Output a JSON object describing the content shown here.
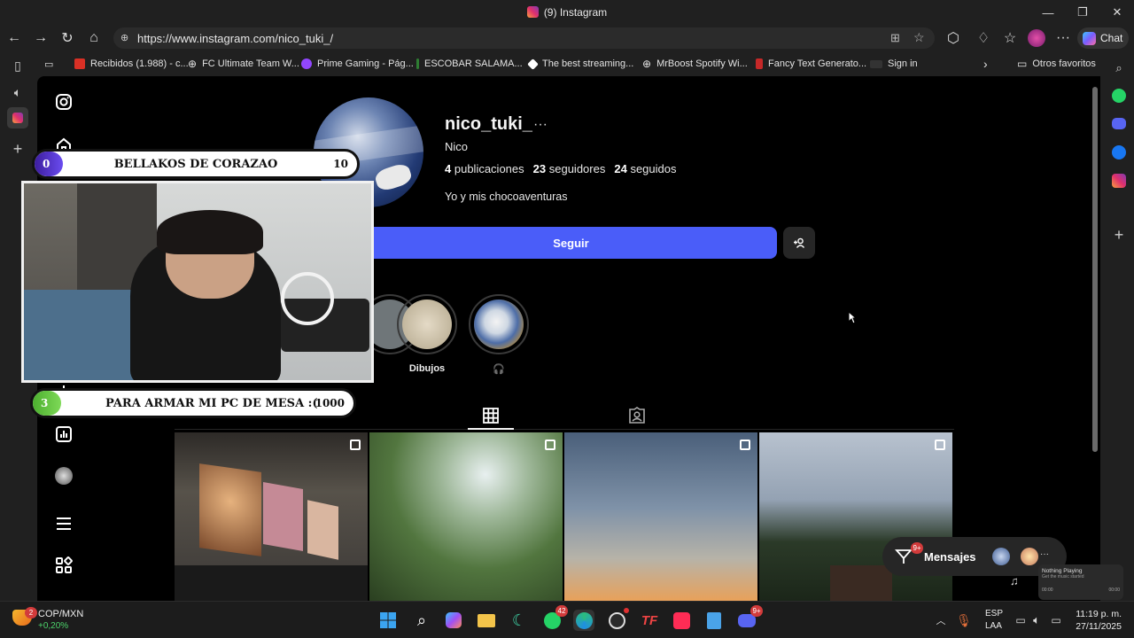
{
  "window": {
    "title": "(9) Instagram"
  },
  "browser": {
    "url": "https://www.instagram.com/nico_tuki_/",
    "chat_label": "Chat",
    "bookmarks": [
      "Recibidos (1.988) - c...",
      "FC Ultimate Team W...",
      "Prime Gaming - Pág...",
      "ESCOBAR SALAMA...",
      "The best streaming...",
      "MrBoost Spotify Wi...",
      "Fancy Text Generato...",
      "Sign in"
    ],
    "other_favorites": "Otros favoritos"
  },
  "profile": {
    "username": "nico_tuki_",
    "more": "···",
    "full_name": "Nico",
    "stats": {
      "posts_n": "4",
      "posts_label": "publicaciones",
      "followers_n": "23",
      "followers_label": "seguidores",
      "following_n": "24",
      "following_label": "seguidos"
    },
    "bio": "Yo y mis chocoaventuras",
    "follow_label": "Seguir",
    "highlights": [
      {
        "label": "Dibujos"
      },
      {
        "label": "🎧"
      }
    ]
  },
  "overlay": {
    "top_bar": {
      "left_num": "0",
      "text": "BELLAKOS DE CORAZAO",
      "right_num": "10"
    },
    "bottom_bar": {
      "left_num": "3",
      "text": "PARA ARMAR MI PC DE MESA :(",
      "right_num": "1000"
    }
  },
  "messages": {
    "label": "Mensajes",
    "badge": "9+"
  },
  "now_playing": {
    "title": "Nothing Playing",
    "subtitle": "Get the music started",
    "time_left": "00:00",
    "time_right": "00:00"
  },
  "taskbar": {
    "stock_name": "COP/MXN",
    "stock_change": "+0,20%",
    "stock_badge": "2",
    "whatsapp_badge": "42",
    "discord_badge": "9+",
    "lang": "ESP",
    "lang2": "LAA",
    "time": "11:19 p. m.",
    "date": "27/11/2025"
  },
  "colors": {
    "follow_button": "#4a5df9",
    "page_bg": "#000000",
    "chrome_bg": "#202020"
  }
}
